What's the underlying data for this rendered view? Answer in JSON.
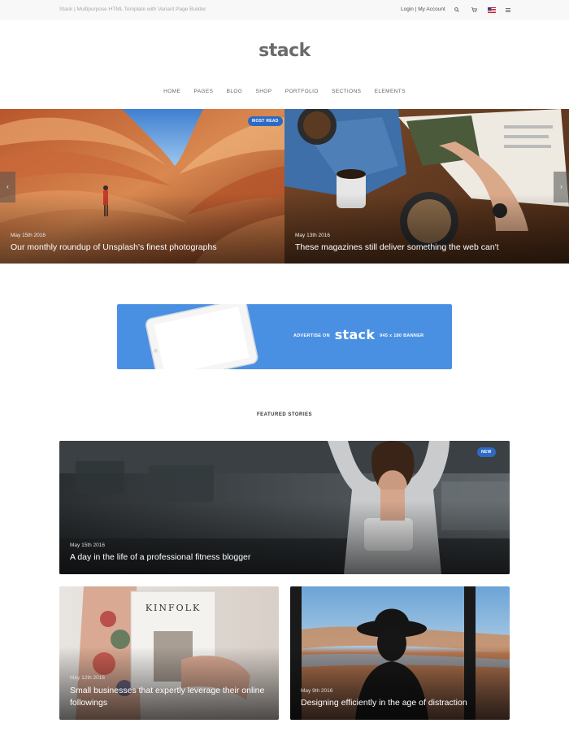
{
  "topbar": {
    "tagline": "Stack | Multipurpose HTML Template with Variant Page Builder",
    "login": "Login",
    "separator": "|",
    "my_account": "My Account"
  },
  "logo": "stack",
  "nav": [
    "HOME",
    "PAGES",
    "BLOG",
    "SHOP",
    "PORTFOLIO",
    "SECTIONS",
    "ELEMENTS"
  ],
  "hero": [
    {
      "date": "May 15th 2016",
      "title": "Our monthly roundup of Unsplash's finest photographs",
      "badge": "MOST READ"
    },
    {
      "date": "May 13th 2016",
      "title": "These magazines still deliver something the web can't"
    }
  ],
  "hero_arrows": {
    "prev": "‹",
    "next": "›"
  },
  "banner": {
    "prefix": "ADVERTISE ON",
    "brand": "stack",
    "suffix": "945 x 180 BANNER"
  },
  "featured": {
    "heading": "FEATURED STORIES",
    "main": {
      "date": "May 15th 2016",
      "title": "A day in the life of a professional fitness blogger",
      "badge": "NEW"
    },
    "cards": [
      {
        "date": "May 12th 2016",
        "title": "Small businesses that expertly leverage their online followings",
        "magazine": "KINFOLK"
      },
      {
        "date": "May 9th 2016",
        "title": "Designing efficiently in the age of distraction"
      }
    ]
  },
  "icons": [
    "search-icon",
    "cart-icon",
    "flag-icon",
    "menu-icon"
  ],
  "colors": {
    "accent": "#4a90e2",
    "badge": "#2e6ac4",
    "topbar": "#f8f8f8"
  }
}
